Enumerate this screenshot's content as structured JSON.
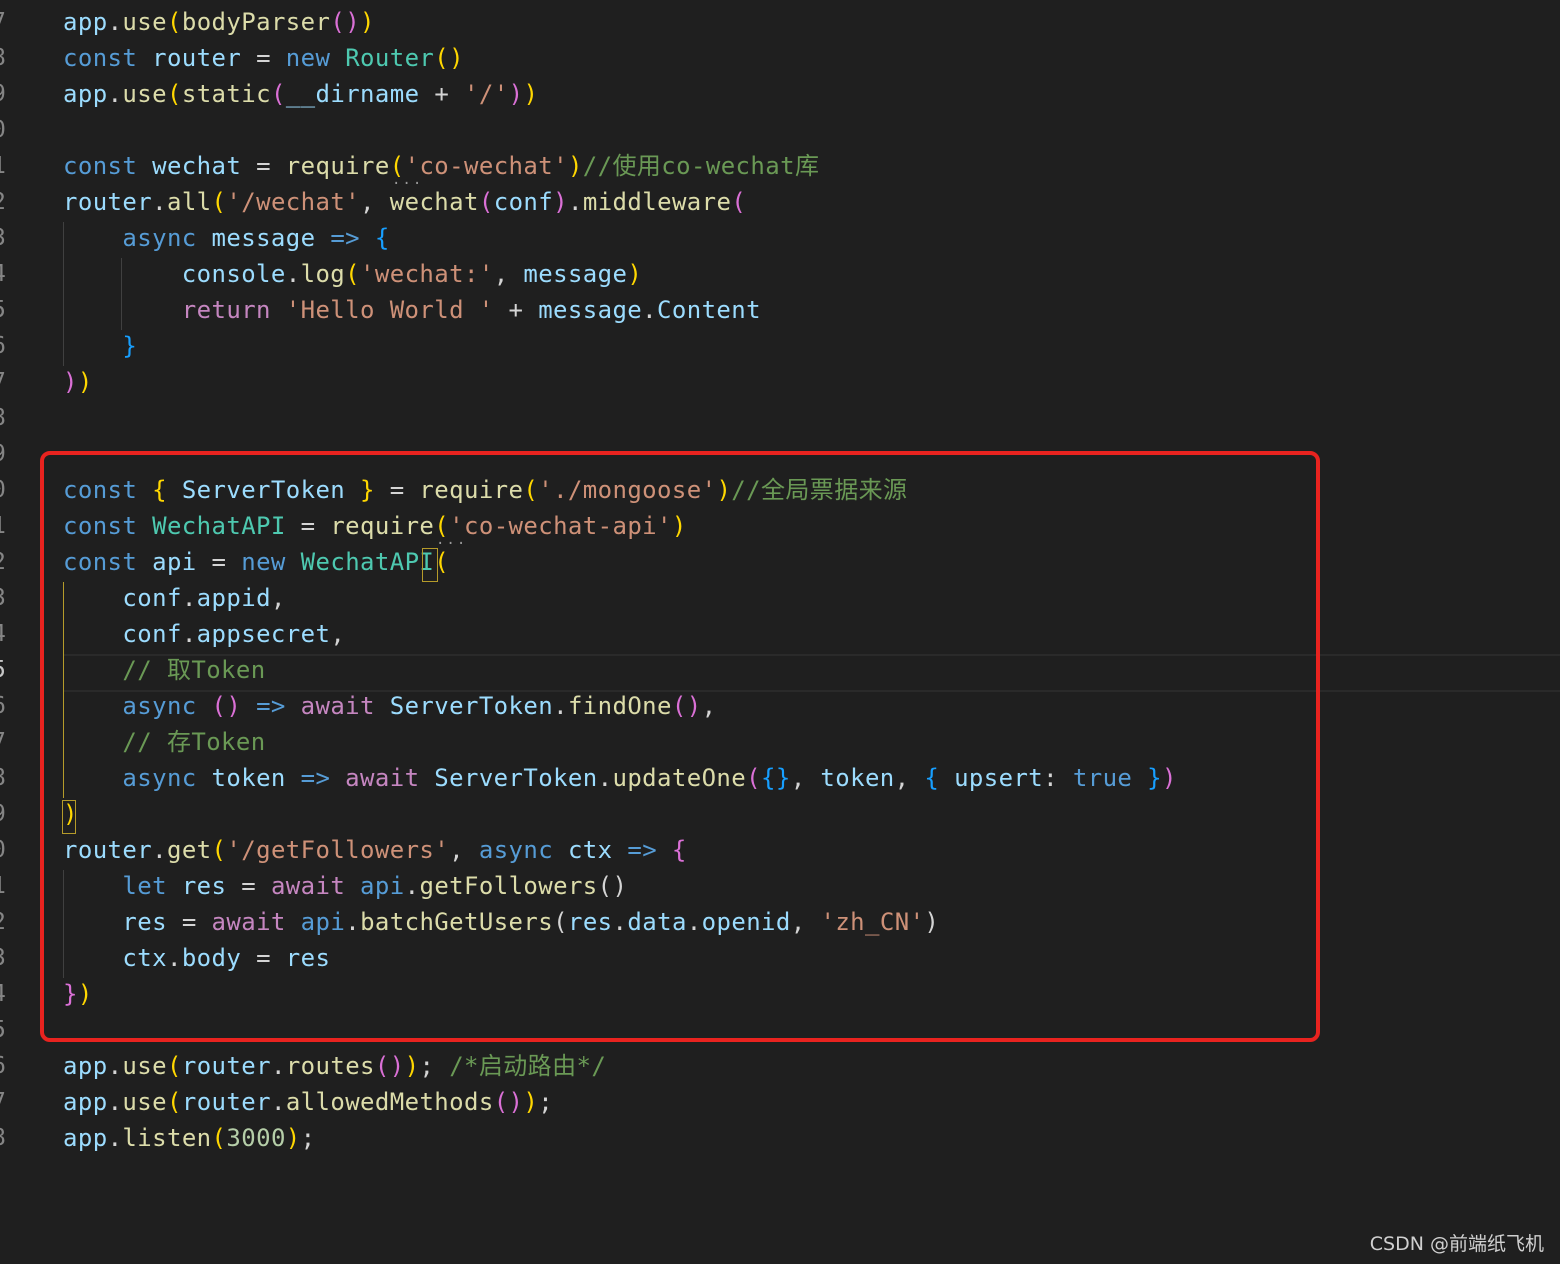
{
  "colors": {
    "background": "#1f1f1f",
    "keyword": "#569cd6",
    "variable": "#9cdcfe",
    "function": "#dcdcaa",
    "class": "#4ec9b0",
    "string": "#ce9178",
    "comment": "#6a9955",
    "control": "#c586c0",
    "number": "#b5cea8",
    "bracket1": "#ffd700",
    "bracket2": "#da70d6",
    "bracket3": "#179fff",
    "highlight_box": "#e8231f"
  },
  "editor": {
    "active_line": "5",
    "lines": [
      {
        "n": "7",
        "tokens": [
          {
            "t": "app",
            "c": "v"
          },
          {
            "t": ".",
            "c": "p"
          },
          {
            "t": "use",
            "c": "f"
          },
          {
            "t": "(",
            "c": "b1"
          },
          {
            "t": "bodyParser",
            "c": "f"
          },
          {
            "t": "()",
            "c": "b2"
          },
          {
            "t": ")",
            "c": "b1"
          }
        ]
      },
      {
        "n": "8",
        "tokens": [
          {
            "t": "const ",
            "c": "k"
          },
          {
            "t": "router",
            "c": "v"
          },
          {
            "t": " = ",
            "c": "p"
          },
          {
            "t": "new ",
            "c": "k"
          },
          {
            "t": "Router",
            "c": "cl"
          },
          {
            "t": "()",
            "c": "b1"
          }
        ]
      },
      {
        "n": "9",
        "tokens": [
          {
            "t": "app",
            "c": "v"
          },
          {
            "t": ".",
            "c": "p"
          },
          {
            "t": "use",
            "c": "f"
          },
          {
            "t": "(",
            "c": "b1"
          },
          {
            "t": "static",
            "c": "f"
          },
          {
            "t": "(",
            "c": "b2"
          },
          {
            "t": "__dirname",
            "c": "v"
          },
          {
            "t": " + ",
            "c": "p"
          },
          {
            "t": "'/'",
            "c": "s"
          },
          {
            "t": ")",
            "c": "b2"
          },
          {
            "t": ")",
            "c": "b1"
          }
        ]
      },
      {
        "n": "0",
        "tokens": []
      },
      {
        "n": "1",
        "tokens": [
          {
            "t": "const ",
            "c": "k"
          },
          {
            "t": "wechat",
            "c": "v"
          },
          {
            "t": " = ",
            "c": "p"
          },
          {
            "t": "require",
            "c": "f"
          },
          {
            "t": "(",
            "c": "b1"
          },
          {
            "t": "'co-wechat'",
            "c": "s"
          },
          {
            "t": ")",
            "c": "b1"
          },
          {
            "t": "//使用co-wechat库",
            "c": "cm"
          }
        ]
      },
      {
        "n": "2",
        "tokens": [
          {
            "t": "router",
            "c": "v"
          },
          {
            "t": ".",
            "c": "p"
          },
          {
            "t": "all",
            "c": "f"
          },
          {
            "t": "(",
            "c": "b1"
          },
          {
            "t": "'/wechat'",
            "c": "s"
          },
          {
            "t": ", ",
            "c": "p"
          },
          {
            "t": "wechat",
            "c": "f"
          },
          {
            "t": "(",
            "c": "b2"
          },
          {
            "t": "conf",
            "c": "v"
          },
          {
            "t": ")",
            "c": "b2"
          },
          {
            "t": ".",
            "c": "p"
          },
          {
            "t": "middleware",
            "c": "f"
          },
          {
            "t": "(",
            "c": "b2"
          }
        ]
      },
      {
        "n": "3",
        "tokens": [
          {
            "t": "    "
          },
          {
            "t": "async ",
            "c": "k"
          },
          {
            "t": "message",
            "c": "v"
          },
          {
            "t": " => ",
            "c": "k"
          },
          {
            "t": "{",
            "c": "b3"
          }
        ]
      },
      {
        "n": "4",
        "tokens": [
          {
            "t": "        "
          },
          {
            "t": "console",
            "c": "v"
          },
          {
            "t": ".",
            "c": "p"
          },
          {
            "t": "log",
            "c": "f"
          },
          {
            "t": "(",
            "c": "b1"
          },
          {
            "t": "'wechat:'",
            "c": "s"
          },
          {
            "t": ", ",
            "c": "p"
          },
          {
            "t": "message",
            "c": "v"
          },
          {
            "t": ")",
            "c": "b1"
          }
        ]
      },
      {
        "n": "5",
        "tokens": [
          {
            "t": "        "
          },
          {
            "t": "return ",
            "c": "ctl"
          },
          {
            "t": "'Hello World '",
            "c": "s"
          },
          {
            "t": " + ",
            "c": "p"
          },
          {
            "t": "message",
            "c": "v"
          },
          {
            "t": ".",
            "c": "p"
          },
          {
            "t": "Content",
            "c": "v"
          }
        ]
      },
      {
        "n": "6",
        "tokens": [
          {
            "t": "    "
          },
          {
            "t": "}",
            "c": "b3"
          }
        ]
      },
      {
        "n": "7",
        "tokens": [
          {
            "t": ")",
            "c": "b2"
          },
          {
            "t": ")",
            "c": "b1"
          }
        ]
      },
      {
        "n": "8",
        "tokens": []
      },
      {
        "n": "9",
        "tokens": []
      },
      {
        "n": "0",
        "tokens": [
          {
            "t": "const ",
            "c": "k"
          },
          {
            "t": "{ ",
            "c": "b1"
          },
          {
            "t": "ServerToken",
            "c": "v"
          },
          {
            "t": " }",
            "c": "b1"
          },
          {
            "t": " = ",
            "c": "p"
          },
          {
            "t": "require",
            "c": "f"
          },
          {
            "t": "(",
            "c": "b1"
          },
          {
            "t": "'./mongoose'",
            "c": "s"
          },
          {
            "t": ")",
            "c": "b1"
          },
          {
            "t": "//全局票据来源",
            "c": "cm"
          }
        ]
      },
      {
        "n": "1",
        "tokens": [
          {
            "t": "const ",
            "c": "k"
          },
          {
            "t": "WechatAPI",
            "c": "cl"
          },
          {
            "t": " = ",
            "c": "p"
          },
          {
            "t": "require",
            "c": "f"
          },
          {
            "t": "(",
            "c": "b1"
          },
          {
            "t": "'co-wechat-api'",
            "c": "s"
          },
          {
            "t": ")",
            "c": "b1"
          }
        ]
      },
      {
        "n": "2",
        "tokens": [
          {
            "t": "const ",
            "c": "k"
          },
          {
            "t": "api",
            "c": "v"
          },
          {
            "t": " = ",
            "c": "p"
          },
          {
            "t": "new ",
            "c": "k"
          },
          {
            "t": "WechatAPI",
            "c": "cl"
          },
          {
            "t": "(",
            "c": "b1"
          }
        ]
      },
      {
        "n": "3",
        "tokens": [
          {
            "t": "    "
          },
          {
            "t": "conf",
            "c": "v"
          },
          {
            "t": ".",
            "c": "p"
          },
          {
            "t": "appid",
            "c": "v"
          },
          {
            "t": ",",
            "c": "p"
          }
        ]
      },
      {
        "n": "4",
        "tokens": [
          {
            "t": "    "
          },
          {
            "t": "conf",
            "c": "v"
          },
          {
            "t": ".",
            "c": "p"
          },
          {
            "t": "appsecret",
            "c": "v"
          },
          {
            "t": ",",
            "c": "p"
          }
        ]
      },
      {
        "n": "5",
        "tokens": [
          {
            "t": "    "
          },
          {
            "t": "// 取Token",
            "c": "cm"
          }
        ]
      },
      {
        "n": "6",
        "tokens": [
          {
            "t": "    "
          },
          {
            "t": "async ",
            "c": "k"
          },
          {
            "t": "()",
            "c": "b2"
          },
          {
            "t": " => ",
            "c": "k"
          },
          {
            "t": "await ",
            "c": "ctl"
          },
          {
            "t": "ServerToken",
            "c": "v"
          },
          {
            "t": ".",
            "c": "p"
          },
          {
            "t": "findOne",
            "c": "f"
          },
          {
            "t": "()",
            "c": "b2"
          },
          {
            "t": ",",
            "c": "p"
          }
        ]
      },
      {
        "n": "7",
        "tokens": [
          {
            "t": "    "
          },
          {
            "t": "// 存Token",
            "c": "cm"
          }
        ]
      },
      {
        "n": "8",
        "tokens": [
          {
            "t": "    "
          },
          {
            "t": "async ",
            "c": "k"
          },
          {
            "t": "token",
            "c": "v"
          },
          {
            "t": " => ",
            "c": "k"
          },
          {
            "t": "await ",
            "c": "ctl"
          },
          {
            "t": "ServerToken",
            "c": "v"
          },
          {
            "t": ".",
            "c": "p"
          },
          {
            "t": "updateOne",
            "c": "f"
          },
          {
            "t": "(",
            "c": "b2"
          },
          {
            "t": "{}",
            "c": "b3"
          },
          {
            "t": ", ",
            "c": "p"
          },
          {
            "t": "token",
            "c": "v"
          },
          {
            "t": ", ",
            "c": "p"
          },
          {
            "t": "{ ",
            "c": "b3"
          },
          {
            "t": "upsert",
            "c": "v"
          },
          {
            "t": ": ",
            "c": "p"
          },
          {
            "t": "true",
            "c": "k"
          },
          {
            "t": " }",
            "c": "b3"
          },
          {
            "t": ")",
            "c": "b2"
          }
        ]
      },
      {
        "n": "9",
        "tokens": [
          {
            "t": ")",
            "c": "b1"
          }
        ]
      },
      {
        "n": "0",
        "tokens": [
          {
            "t": "router",
            "c": "v"
          },
          {
            "t": ".",
            "c": "p"
          },
          {
            "t": "get",
            "c": "f"
          },
          {
            "t": "(",
            "c": "b1"
          },
          {
            "t": "'/getFollowers'",
            "c": "s"
          },
          {
            "t": ", ",
            "c": "p"
          },
          {
            "t": "async ",
            "c": "k"
          },
          {
            "t": "ctx",
            "c": "v"
          },
          {
            "t": " => ",
            "c": "k"
          },
          {
            "t": "{",
            "c": "b2"
          }
        ]
      },
      {
        "n": "1",
        "tokens": [
          {
            "t": "    "
          },
          {
            "t": "let ",
            "c": "k"
          },
          {
            "t": "res",
            "c": "v"
          },
          {
            "t": " = ",
            "c": "p"
          },
          {
            "t": "await ",
            "c": "ctl"
          },
          {
            "t": "api",
            "c": "k"
          },
          {
            "t": ".",
            "c": "p"
          },
          {
            "t": "getFollowers",
            "c": "f"
          },
          {
            "t": "()",
            "c": "p"
          }
        ]
      },
      {
        "n": "2",
        "tokens": [
          {
            "t": "    "
          },
          {
            "t": "res",
            "c": "v"
          },
          {
            "t": " = ",
            "c": "p"
          },
          {
            "t": "await ",
            "c": "ctl"
          },
          {
            "t": "api",
            "c": "k"
          },
          {
            "t": ".",
            "c": "p"
          },
          {
            "t": "batchGetUsers",
            "c": "f"
          },
          {
            "t": "(",
            "c": "p"
          },
          {
            "t": "res",
            "c": "v"
          },
          {
            "t": ".",
            "c": "p"
          },
          {
            "t": "data",
            "c": "v"
          },
          {
            "t": ".",
            "c": "p"
          },
          {
            "t": "openid",
            "c": "v"
          },
          {
            "t": ", ",
            "c": "p"
          },
          {
            "t": "'zh_CN'",
            "c": "s"
          },
          {
            "t": ")",
            "c": "p"
          }
        ]
      },
      {
        "n": "3",
        "tokens": [
          {
            "t": "    "
          },
          {
            "t": "ctx",
            "c": "v"
          },
          {
            "t": ".",
            "c": "p"
          },
          {
            "t": "body",
            "c": "v"
          },
          {
            "t": " = ",
            "c": "p"
          },
          {
            "t": "res",
            "c": "v"
          }
        ]
      },
      {
        "n": "4",
        "tokens": [
          {
            "t": "}",
            "c": "b2"
          },
          {
            "t": ")",
            "c": "b1"
          }
        ]
      },
      {
        "n": "5",
        "tokens": []
      },
      {
        "n": "6",
        "tokens": [
          {
            "t": "app",
            "c": "v"
          },
          {
            "t": ".",
            "c": "p"
          },
          {
            "t": "use",
            "c": "f"
          },
          {
            "t": "(",
            "c": "b1"
          },
          {
            "t": "router",
            "c": "v"
          },
          {
            "t": ".",
            "c": "p"
          },
          {
            "t": "routes",
            "c": "f"
          },
          {
            "t": "()",
            "c": "b2"
          },
          {
            "t": ")",
            "c": "b1"
          },
          {
            "t": "; ",
            "c": "p"
          },
          {
            "t": "/*启动路由*/",
            "c": "cm"
          }
        ]
      },
      {
        "n": "7",
        "tokens": [
          {
            "t": "app",
            "c": "v"
          },
          {
            "t": ".",
            "c": "p"
          },
          {
            "t": "use",
            "c": "f"
          },
          {
            "t": "(",
            "c": "b1"
          },
          {
            "t": "router",
            "c": "v"
          },
          {
            "t": ".",
            "c": "p"
          },
          {
            "t": "allowedMethods",
            "c": "f"
          },
          {
            "t": "()",
            "c": "b2"
          },
          {
            "t": ")",
            "c": "b1"
          },
          {
            "t": ";",
            "c": "p"
          }
        ]
      },
      {
        "n": "8",
        "tokens": [
          {
            "t": "app",
            "c": "v"
          },
          {
            "t": ".",
            "c": "p"
          },
          {
            "t": "listen",
            "c": "f"
          },
          {
            "t": "(",
            "c": "b1"
          },
          {
            "t": "3000",
            "c": "num"
          },
          {
            "t": ")",
            "c": "b1"
          },
          {
            "t": ";",
            "c": "p"
          }
        ]
      }
    ]
  },
  "watermark": "CSDN @前端纸飞机"
}
